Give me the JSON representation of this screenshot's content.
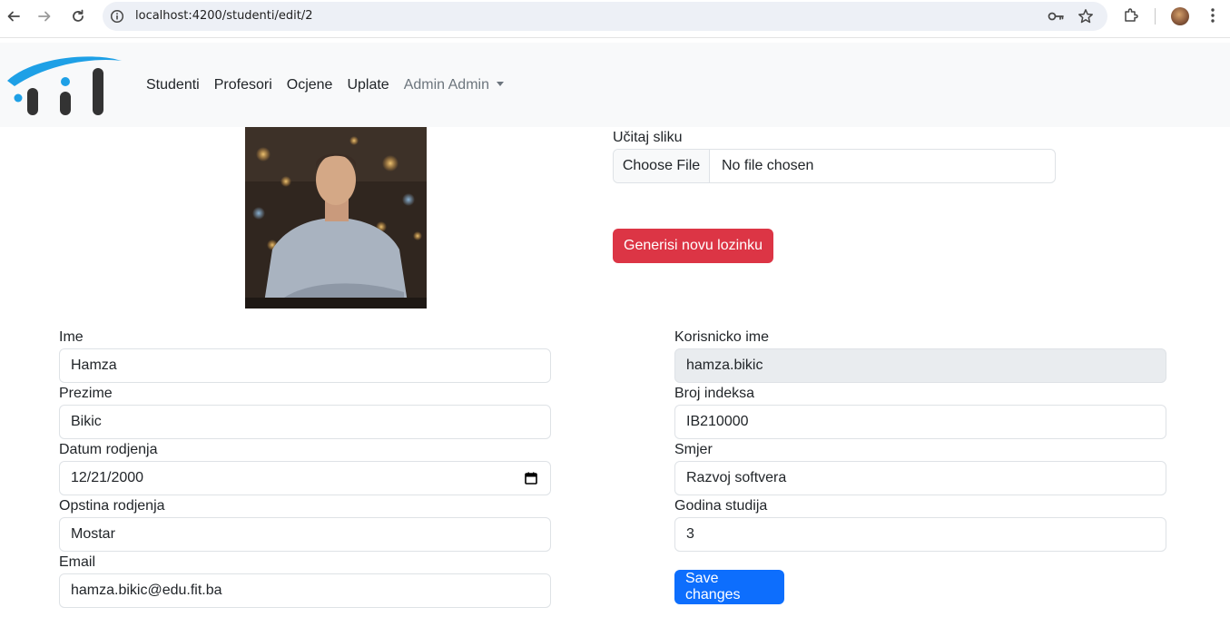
{
  "browser": {
    "url": "localhost:4200/studenti/edit/2"
  },
  "navbar": {
    "links": [
      "Studenti",
      "Profesori",
      "Ocjene",
      "Uplate"
    ],
    "user_menu": "Admin Admin"
  },
  "upload": {
    "label": "Učitaj sliku",
    "button": "Choose File",
    "file_status": "No file chosen"
  },
  "actions": {
    "generate_password": "Generisi novu lozinku",
    "save": "Save changes"
  },
  "form": {
    "left": [
      {
        "label": "Ime",
        "value": "Hamza"
      },
      {
        "label": "Prezime",
        "value": "Bikic"
      },
      {
        "label": "Datum rodjenja",
        "value": "12/21/2000"
      },
      {
        "label": "Opstina rodjenja",
        "value": "Mostar"
      },
      {
        "label": "Email",
        "value": "hamza.bikic@edu.fit.ba"
      }
    ],
    "right": [
      {
        "label": "Korisnicko ime",
        "value": "hamza.bikic"
      },
      {
        "label": "Broj indeksa",
        "value": "IB210000"
      },
      {
        "label": "Smjer",
        "value": "Razvoj softvera"
      },
      {
        "label": "Godina studija",
        "value": "3"
      }
    ]
  },
  "colors": {
    "danger": "#dc3545",
    "primary": "#0d6efd",
    "logo_blue": "#1ea0e6",
    "logo_dark": "#333333"
  }
}
